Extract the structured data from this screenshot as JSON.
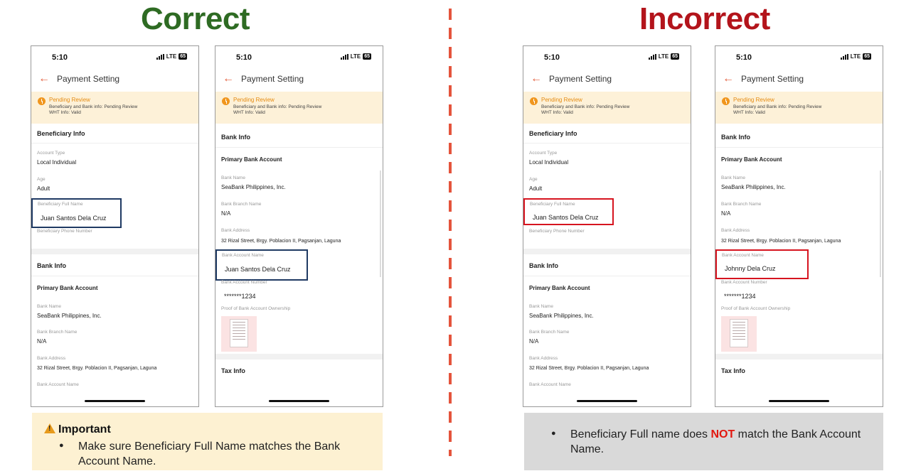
{
  "correct_heading": "Correct",
  "incorrect_heading": "Incorrect",
  "phone": {
    "time": "5:10",
    "network": "LTE",
    "battery": "65",
    "title": "Payment Setting",
    "pending_title": "Pending Review",
    "pending_line1": "Beneficiary and Bank info: Pending Review",
    "pending_line2": "WHT Info: Valid"
  },
  "beneficiary": {
    "section": "Beneficiary Info",
    "account_type_label": "Account Type",
    "account_type": "Local Individual",
    "age_label": "Age",
    "age": "Adult",
    "full_name_label": "Beneficiary Full Name",
    "full_name": "Juan Santos Dela Cruz",
    "phone_label": "Beneficiary Phone Number"
  },
  "bank": {
    "section": "Bank Info",
    "primary": "Primary Bank Account",
    "bank_name_label": "Bank Name",
    "bank_name": "SeaBank Philippines, Inc.",
    "branch_label": "Bank Branch Name",
    "branch": "N/A",
    "address_label": "Bank Address",
    "address": "32 Rizal Street, Brgy. Poblacion II, Pagsanjan, Laguna",
    "account_name_label": "Bank Account Name",
    "account_name_correct": "Juan Santos Dela Cruz",
    "account_name_incorrect": "Johnny Dela Cruz",
    "account_number_label": "Bank Account Number",
    "account_number": "*******1234",
    "proof_label": "Proof of Bank Account Ownership",
    "tax_section": "Tax Info"
  },
  "note": {
    "title": "Important",
    "bullet": "●",
    "text": "Make sure Beneficiary Full Name matches the Bank Account Name."
  },
  "error": {
    "bullet": "●",
    "text_before": "Beneficiary Full name does ",
    "text_not": "NOT",
    "text_after": " match the Bank Account Name."
  },
  "colors": {
    "correct": "#2e6b23",
    "incorrect": "#b3141b",
    "divider": "#e4543c",
    "highlight_correct": "#1f3a63",
    "highlight_incorrect": "#d6141f",
    "accent": "#e4603f",
    "banner": "#fdf1d8"
  }
}
